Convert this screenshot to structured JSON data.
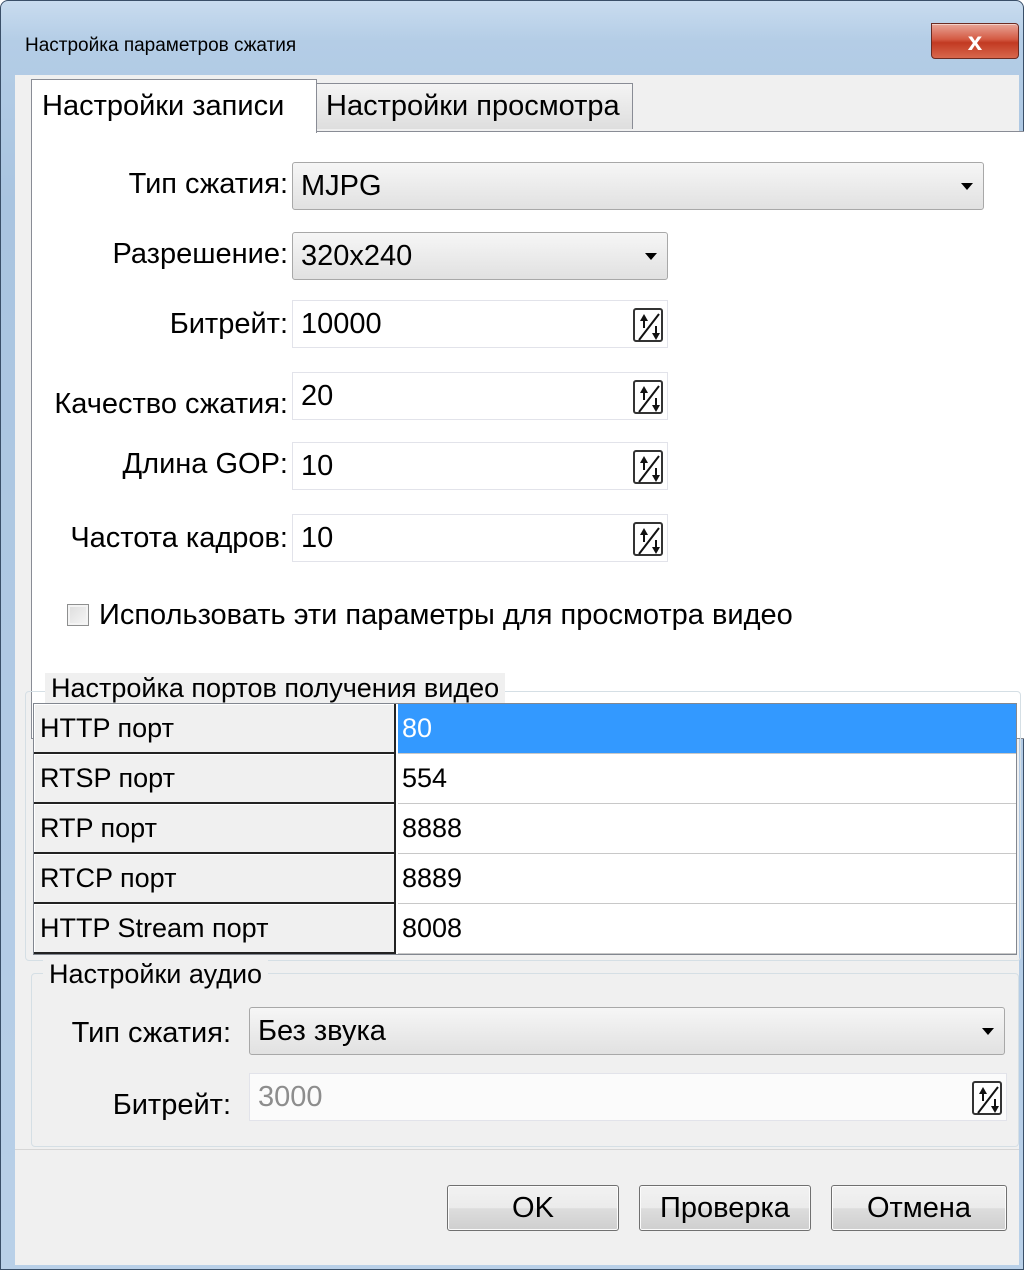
{
  "window": {
    "title": "Настройка параметров сжатия",
    "close_glyph": "x"
  },
  "tabs": [
    {
      "label": "Настройки записи",
      "active": true
    },
    {
      "label": "Настройки просмотра",
      "active": false
    }
  ],
  "record": {
    "compression_type": {
      "label": "Тип сжатия:",
      "value": "MJPG"
    },
    "resolution": {
      "label": "Разрешение:",
      "value": "320x240"
    },
    "bitrate": {
      "label": "Битрейт:",
      "value": "10000"
    },
    "quality": {
      "label": "Качество сжатия:",
      "value": "20"
    },
    "gop": {
      "label": "Длина GOP:",
      "value": "10"
    },
    "framerate": {
      "label": "Частота кадров:",
      "value": "10"
    },
    "use_for_view": {
      "label": "Использовать эти параметры для просмотра видео",
      "checked": false
    }
  },
  "ports": {
    "title": "Настройка портов получения видео",
    "rows": [
      {
        "key": "HTTP порт",
        "value": "80",
        "selected": true
      },
      {
        "key": "RTSP порт",
        "value": "554",
        "selected": false
      },
      {
        "key": "RTP порт",
        "value": "8888",
        "selected": false
      },
      {
        "key": "RTCP порт",
        "value": "8889",
        "selected": false
      },
      {
        "key": "HTTP Stream порт",
        "value": "8008",
        "selected": false
      }
    ]
  },
  "audio": {
    "title": "Настройки аудио",
    "compression_type": {
      "label": "Тип сжатия:",
      "value": "Без звука"
    },
    "bitrate": {
      "label": "Битрейт:",
      "value": "3000",
      "disabled": true
    }
  },
  "buttons": {
    "ok": "OK",
    "check": "Проверка",
    "cancel": "Отмена"
  },
  "colors": {
    "selection": "#3399ff",
    "close_button": "#c23a22",
    "dialog_bg": "#f0f0f0"
  }
}
